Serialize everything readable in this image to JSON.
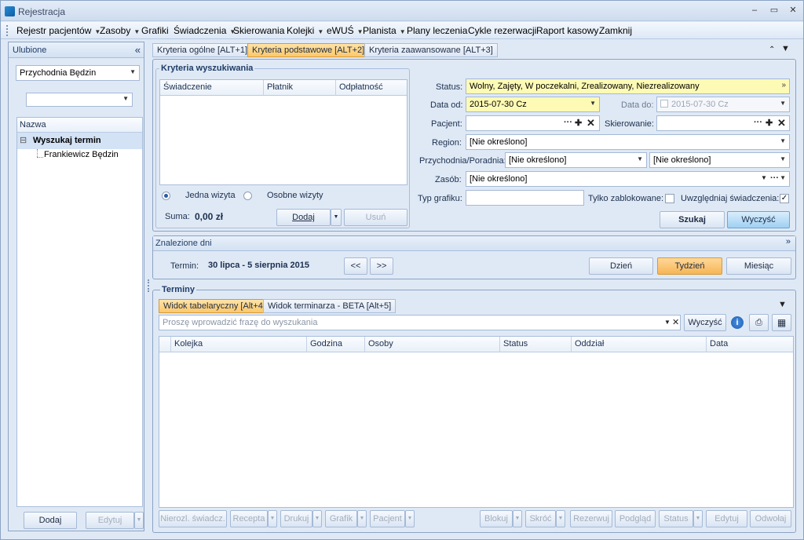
{
  "window": {
    "title": "Rejestracja",
    "min": "–",
    "restore": "▭",
    "close": "✕"
  },
  "menu": [
    {
      "label": "Rejestr pacjentów",
      "dropdown": true
    },
    {
      "label": "Zasoby",
      "dropdown": true
    },
    {
      "label": "Grafiki",
      "dropdown": false
    },
    {
      "label": "Świadczenia",
      "dropdown": true
    },
    {
      "label": "Skierowania",
      "dropdown": false
    },
    {
      "label": "Kolejki",
      "dropdown": true
    },
    {
      "label": "eWUŚ",
      "dropdown": true
    },
    {
      "label": "Planista",
      "dropdown": true
    },
    {
      "label": "Plany leczenia",
      "dropdown": false
    },
    {
      "label": "Cykle rezerwacji",
      "dropdown": false
    },
    {
      "label": "Raport kasowy",
      "dropdown": false
    },
    {
      "label": "Zamknij",
      "dropdown": false
    }
  ],
  "favorites": {
    "title": "Ulubione",
    "collapse": "«",
    "clinic": "Przychodnia Będzin",
    "second_combo": "",
    "column": "Nazwa",
    "tree_root": "Wyszukaj termin",
    "tree_child": "Frankiewicz Będzin",
    "tree_toggle": "⊟",
    "add_button": "Dodaj",
    "edit_button": "Edytuj"
  },
  "criteria_tabs": [
    "Kryteria ogólne [ALT+1]",
    "Kryteria podstawowe [ALT+2]",
    "Kryteria zaawansowane [ALT+3]"
  ],
  "criteria": {
    "group_title": "Kryteria wyszukiwania",
    "table_headers": [
      "Świadczenie",
      "Płatnik",
      "Odpłatność"
    ],
    "radio_one": "Jedna wizyta",
    "radio_separate": "Osobne wizyty",
    "sum_label": "Suma:",
    "sum_value": "0,00 zł",
    "add_button": "Dodaj",
    "remove_button": "Usuń",
    "status_label": "Status:",
    "status_value": "Wolny, Zajęty, W poczekalni, Zrealizowany, Niezrealizowany",
    "date_from_label": "Data od:",
    "date_from": "2015-07-30 Cz",
    "date_to_label": "Data do:",
    "date_to": "2015-07-30 Cz",
    "patient_label": "Pacjent:",
    "referral_label": "Skierowanie:",
    "region_label": "Region:",
    "region_value": "[Nie określono]",
    "clinic_label": "Przychodnia/Poradnia:",
    "clinic_value": "[Nie określono]",
    "clinic_value2": "[Nie określono]",
    "resource_label": "Zasób:",
    "resource_value": "[Nie określono]",
    "schedule_type_label": "Typ grafiku:",
    "blocked_only_label": "Tylko zablokowane:",
    "include_services_label": "Uwzględniaj świadczenia:",
    "include_services_checked": "✓",
    "search_button": "Szukaj",
    "clear_button": "Wyczyść"
  },
  "found_days": {
    "title": "Znalezione dni",
    "term_label": "Termin:",
    "term_value": "30 lipca - 5 sierpnia 2015",
    "prev": "<<",
    "next": ">>",
    "day": "Dzień",
    "week": "Tydzień",
    "month": "Miesiąc"
  },
  "terms": {
    "title": "Terminy",
    "tabs": [
      "Widok tabelaryczny [Alt+4]",
      "Widok terminarza - BETA [Alt+5]"
    ],
    "search_placeholder": "Proszę wprowadzić frazę do wyszukania",
    "clear_button": "Wyczyść",
    "columns": [
      "Kolejka",
      "Godzina",
      "Osoby",
      "Status",
      "Oddział",
      "Data"
    ],
    "bottom_buttons": [
      "Nierozl. świadcz.",
      "Recepta",
      "Drukuj",
      "Grafik",
      "Pacjent",
      "Blokuj",
      "Skróć",
      "Rezerwuj",
      "Podgląd",
      "Status",
      "Edytuj",
      "Odwołaj"
    ]
  }
}
